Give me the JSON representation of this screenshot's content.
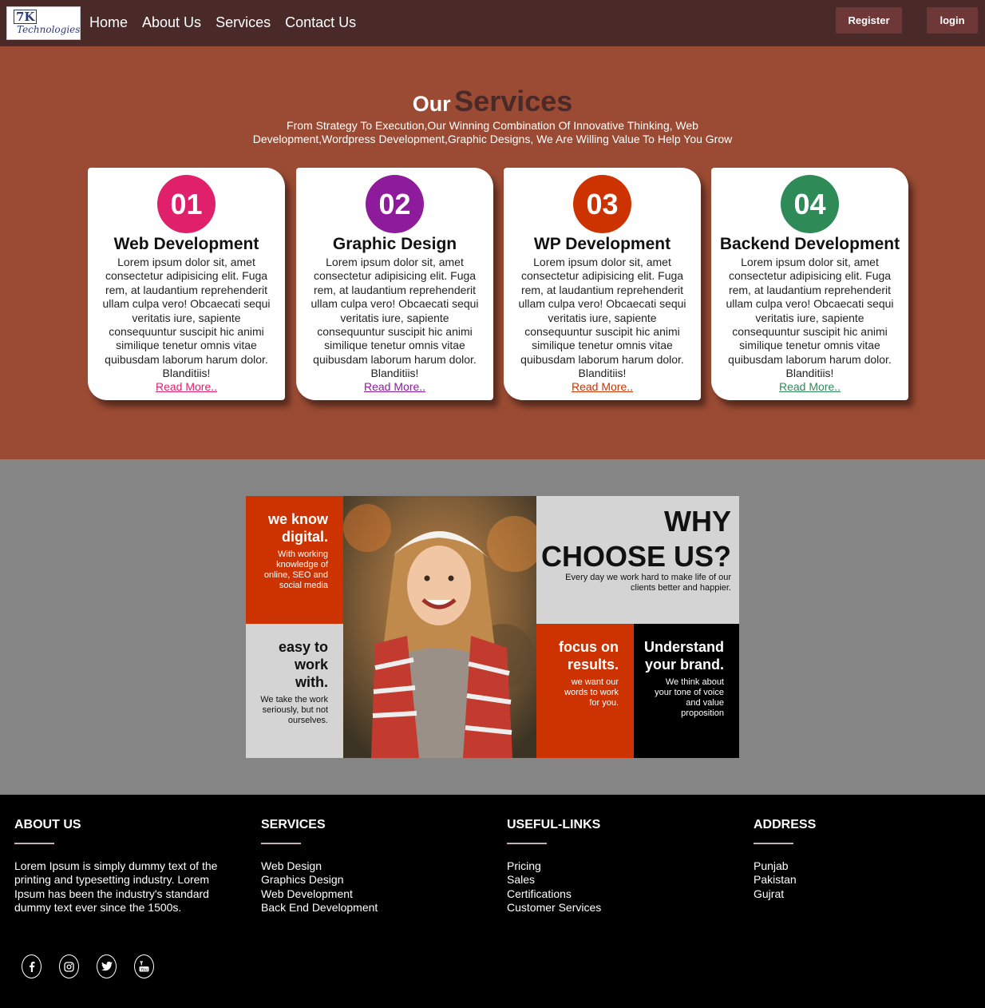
{
  "nav": {
    "logo_mark": "7K",
    "logo_word": "Technologies",
    "links": [
      "Home",
      "About Us",
      "Services",
      "Contact Us"
    ],
    "register": "Register",
    "login": "login"
  },
  "services": {
    "title_our": "Our",
    "title_services": "Services",
    "subtitle": "From Strategy To Execution,Our Winning Combination Of Innovative Thinking, Web Development,Wordpress Development,Graphic Designs, We Are Willing Value To Help You Grow",
    "cards": [
      {
        "num": "01",
        "title": "Web Development",
        "body": "Lorem ipsum dolor sit, amet consectetur adipisicing elit. Fuga rem, at laudantium reprehenderit ullam culpa vero! Obcaecati sequi veritatis iure, sapiente consequuntur suscipit hic animi similique tenetur omnis vitae quibusdam laborum harum dolor. Blanditiis!",
        "more": "Read More..",
        "color": "#e0206b"
      },
      {
        "num": "02",
        "title": "Graphic Design",
        "body": "Lorem ipsum dolor sit, amet consectetur adipisicing elit. Fuga rem, at laudantium reprehenderit ullam culpa vero! Obcaecati sequi veritatis iure, sapiente consequuntur suscipit hic animi similique tenetur omnis vitae quibusdam laborum harum dolor. Blanditiis!",
        "more": "Read More..",
        "color": "#8e1a9c"
      },
      {
        "num": "03",
        "title": "WP Development",
        "body": "Lorem ipsum dolor sit, amet consectetur adipisicing elit. Fuga rem, at laudantium reprehenderit ullam culpa vero! Obcaecati sequi veritatis iure, sapiente consequuntur suscipit hic animi similique tenetur omnis vitae quibusdam laborum harum dolor. Blanditiis!",
        "more": "Read More..",
        "color": "#cc3300"
      },
      {
        "num": "04",
        "title": "Backend Development",
        "body": "Lorem ipsum dolor sit, amet consectetur adipisicing elit. Fuga rem, at laudantium reprehenderit ullam culpa vero! Obcaecati sequi veritatis iure, sapiente consequuntur suscipit hic animi similique tenetur omnis vitae quibusdam laborum harum dolor. Blanditiis!",
        "more": "Read More..",
        "color": "#2e8b57"
      }
    ]
  },
  "why": {
    "know_h": "we know digital.",
    "know_p": "With working knowledge of online, SEO and social media",
    "easy_h": "easy to work with.",
    "easy_p": "We take the work seriously, but not ourselves.",
    "why_h": "WHY CHOOSE US?",
    "why_p": "Every day we work hard to make life of our clients better and happier.",
    "focus_h": "focus on results.",
    "focus_p": "we want our words to work for you.",
    "brand_h": "Understand your brand.",
    "brand_p": "We think about your tone of voice and value proposition"
  },
  "footer": {
    "about": {
      "heading": "ABOUT US",
      "text": "Lorem Ipsum is simply dummy text of the printing and typesetting industry. Lorem Ipsum has been the industry's standard dummy text ever since the 1500s."
    },
    "services": {
      "heading": "SERVICES",
      "items": [
        "Web Design",
        "Graphics Design",
        "Web Development",
        "Back End Development"
      ]
    },
    "links": {
      "heading": "USEFUL-LINKS",
      "items": [
        "Pricing",
        "Sales",
        "Certifications",
        "Customer Services"
      ]
    },
    "address": {
      "heading": "ADDRESS",
      "items": [
        "Punjab",
        "Pakistan",
        "Gujrat"
      ]
    },
    "socials": [
      "facebook-icon",
      "instagram-icon",
      "twitter-icon",
      "youtube-icon"
    ]
  }
}
